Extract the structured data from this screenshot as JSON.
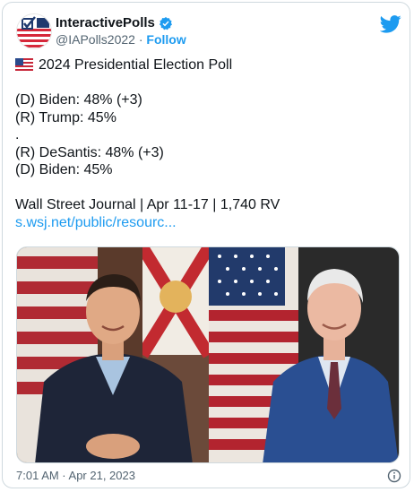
{
  "account": {
    "name": "InteractivePolls",
    "handle": "@IAPolls2022",
    "separator": "·",
    "follow_label": "Follow"
  },
  "icons": {
    "verified": "verified-badge-icon",
    "brand": "twitter-bird-icon",
    "flag": "us-flag-icon",
    "info": "info-icon"
  },
  "tweet": {
    "title": "2024 Presidential Election Poll",
    "lines": [
      "(D) Biden: 48% (+3)",
      "(R) Trump: 45%",
      ".",
      "(R) DeSantis: 48% (+3)",
      "(D) Biden: 45%"
    ],
    "source": "Wall Street Journal | Apr 11-17 | 1,740 RV",
    "link": "s.wsj.net/public/resourc..."
  },
  "footer": {
    "timestamp": "7:01 AM · Apr 21, 2023"
  },
  "colors": {
    "accent": "#1d9bf0",
    "text": "#0f1419",
    "secondary": "#536471"
  }
}
